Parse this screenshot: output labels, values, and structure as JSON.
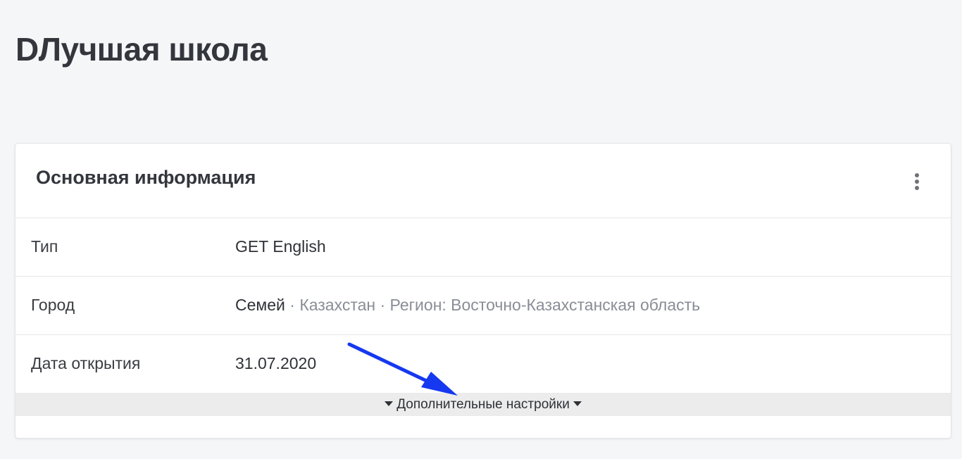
{
  "page": {
    "title": "DЛучшая школа"
  },
  "card": {
    "title": "Основная информация",
    "menu_icon": "kebab-menu-icon",
    "rows": [
      {
        "label": "Тип",
        "value": "GET English"
      },
      {
        "label": "Город",
        "city": "Семей",
        "sep1": " · ",
        "country": "Казахстан",
        "sep2": " · ",
        "region": "Регион: Восточно-Казахстанская область"
      },
      {
        "label": "Дата открытия",
        "value": "31.07.2020"
      }
    ],
    "advanced_label": "Дополнительные настройки"
  },
  "annotation": {
    "color": "#1638f0"
  }
}
